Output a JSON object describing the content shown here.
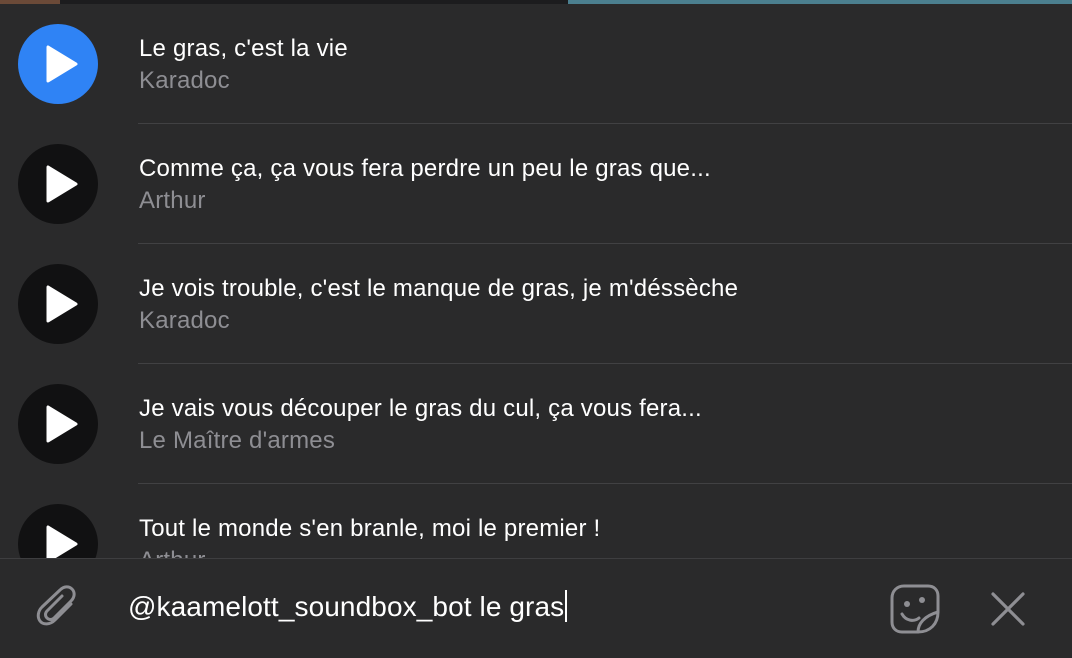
{
  "results": [
    {
      "title": "Le gras, c'est la vie",
      "artist": "Karadoc",
      "active": true
    },
    {
      "title": "Comme ça, ça vous fera perdre un peu le gras que...",
      "artist": "Arthur",
      "active": false
    },
    {
      "title": "Je vois trouble, c'est le manque de gras, je m'déssèche",
      "artist": "Karadoc",
      "active": false
    },
    {
      "title": "Je vais vous découper le gras du cul, ça vous fera...",
      "artist": "Le Maître d'armes",
      "active": false
    },
    {
      "title": "Tout le monde s'en branle, moi le premier !",
      "artist": "Arthur",
      "active": false
    }
  ],
  "input": {
    "query": "@kaamelott_soundbox_bot le gras"
  },
  "icons": {
    "play": "play-icon",
    "attach": "paperclip-icon",
    "sticker": "sticker-icon",
    "close": "close-icon"
  },
  "colors": {
    "background": "#2a2a2b",
    "accent": "#2f83f5",
    "play_button": "#111112",
    "secondary_text": "#8e8e93",
    "separator": "#414143"
  }
}
